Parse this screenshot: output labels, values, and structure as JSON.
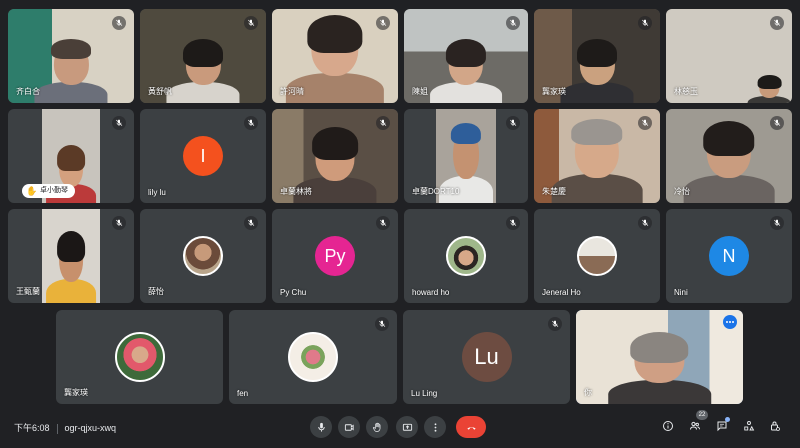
{
  "participants": [
    {
      "name": "齐白合",
      "muted": true
    },
    {
      "name": "黃舒帆",
      "muted": true
    },
    {
      "name": "許河晴",
      "muted": true
    },
    {
      "name": "陳姐",
      "muted": true
    },
    {
      "name": "龔家瑛",
      "muted": true
    },
    {
      "name": "林慈玉",
      "muted": true
    },
    {
      "name": "",
      "muted": true,
      "hand_label": "卓小勤琴"
    },
    {
      "name": "lily lu",
      "muted": true,
      "avatar_letter": "I",
      "avatar_color": "#f4511e"
    },
    {
      "name": "卓蘭林將",
      "muted": true
    },
    {
      "name": "卓蘭DORT10",
      "muted": true
    },
    {
      "name": "朱楚慶",
      "muted": true
    },
    {
      "name": "冷怡",
      "muted": true
    },
    {
      "name": "王甄蘭",
      "muted": true
    },
    {
      "name": "薛怡",
      "muted": true
    },
    {
      "name": "Py Chu",
      "muted": true,
      "avatar_letter": "Py",
      "avatar_color": "#e52592"
    },
    {
      "name": "howard ho",
      "muted": true
    },
    {
      "name": "Jeneral Ho",
      "muted": true
    },
    {
      "name": "Nini",
      "muted": true,
      "avatar_letter": "N",
      "avatar_color": "#1e88e5"
    },
    {
      "name": "龔家瑛",
      "muted": false
    },
    {
      "name": "fen",
      "muted": true
    },
    {
      "name": "Lu Ling",
      "muted": true,
      "avatar_letter": "Lu",
      "avatar_color": "#6d4c41"
    },
    {
      "name": "你",
      "muted": false
    }
  ],
  "bottombar": {
    "time": "下午6:08",
    "meeting_code": "ogr-qjxu-xwq",
    "people_count": "22"
  },
  "colors": {
    "background": "#202124",
    "tile": "#3c4043",
    "end_call": "#ea4335",
    "self_outline": "#8ab4f8"
  },
  "icons": {
    "mic": "mic-icon",
    "camera": "camera-icon",
    "raise_hand": "raise-hand-icon",
    "present": "present-screen-icon",
    "more": "more-options-icon",
    "end_call": "end-call-icon",
    "info": "info-icon",
    "people": "people-icon",
    "chat": "chat-icon",
    "activities": "activities-icon",
    "host_controls": "host-controls-icon"
  }
}
